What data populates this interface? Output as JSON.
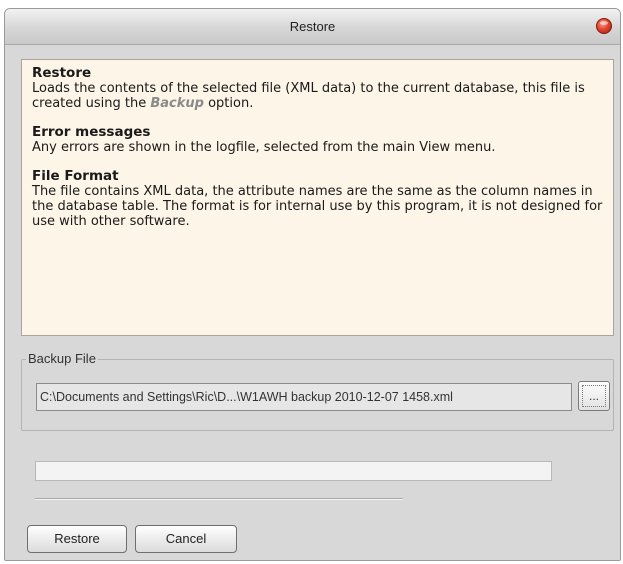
{
  "window": {
    "title": "Restore"
  },
  "help": {
    "sections": [
      {
        "heading": "Restore",
        "text_before": "Loads the contents of the selected file (XML data) to the current database, this file is created using the ",
        "emphasis": "Backup",
        "text_after": " option."
      },
      {
        "heading": "Error messages",
        "text": "Any errors are shown in the logfile, selected from the main View menu."
      },
      {
        "heading": "File Format",
        "text": "The file contains XML data, the attribute names are the same as the column names in the database table. The format is for internal use by this program, it is not designed for use with other software."
      }
    ]
  },
  "backup_file": {
    "group_label": "Backup File",
    "path_value": "C:\\Documents and Settings\\Ric\\D...\\W1AWH backup 2010-12-07 1458.xml",
    "browse_label": "..."
  },
  "progress": {
    "value": 0
  },
  "buttons": {
    "restore_label": "Restore",
    "cancel_label": "Cancel"
  },
  "colors": {
    "help_background": "#fdf5e7",
    "dialog_background": "#d8d8d8",
    "close_button": "#e2452f"
  }
}
